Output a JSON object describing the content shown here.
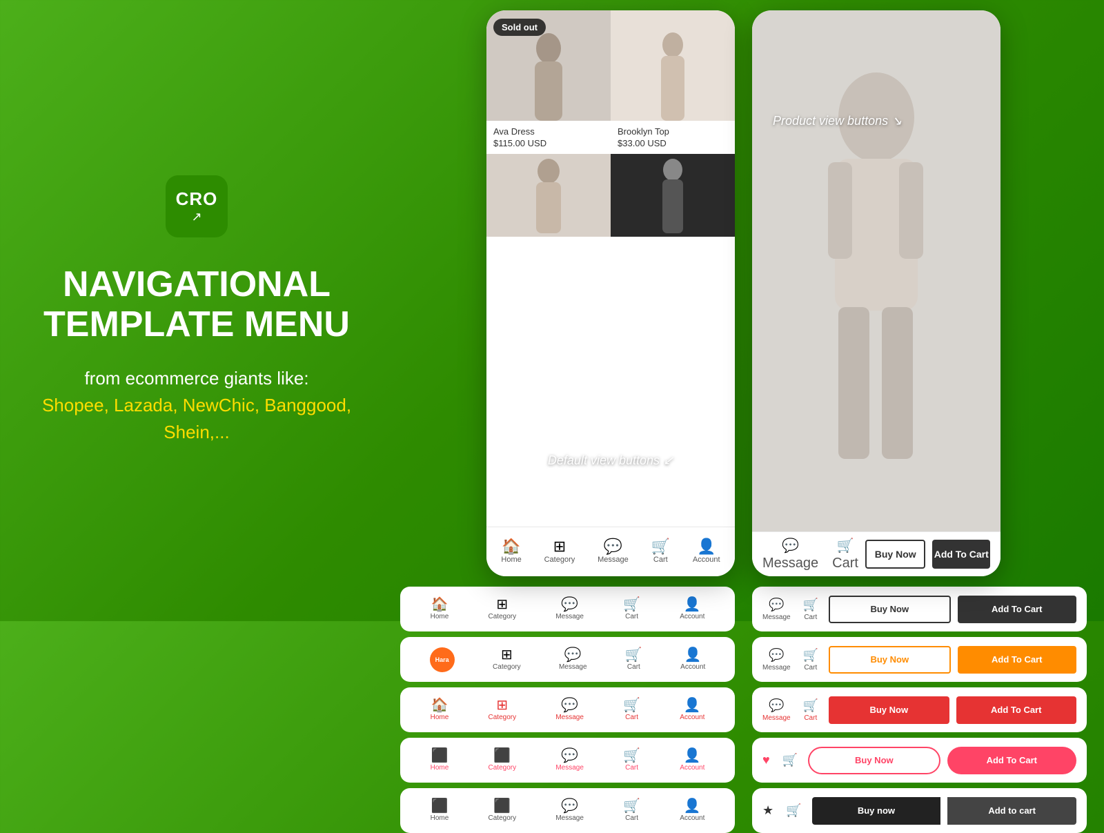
{
  "left": {
    "logo_text": "CRO",
    "title_line1": "NAVIGATIONAL",
    "title_line2": "TEMPLATE MENU",
    "subtitle_prefix": "from ecommerce giants like:",
    "subtitle_highlight": "Shopee, Lazada, NewChic, Banggood, Shein,..."
  },
  "phone_default": {
    "label": "Default view buttons",
    "products": [
      {
        "name": "Ava Dress",
        "price": "$115.00 USD",
        "sold_out": true
      },
      {
        "name": "Brooklyn Top",
        "price": "$33.00 USD",
        "sold_out": false
      }
    ],
    "nav": {
      "items": [
        {
          "icon": "🏠",
          "label": "Home"
        },
        {
          "icon": "⊞",
          "label": "Category"
        },
        {
          "icon": "💬",
          "label": "Message"
        },
        {
          "icon": "🛒",
          "label": "Cart"
        },
        {
          "icon": "👤",
          "label": "Account"
        }
      ]
    }
  },
  "phone_product": {
    "label": "Product view buttons",
    "nav_icons": [
      {
        "icon": "💬",
        "label": "Message"
      },
      {
        "icon": "🛒",
        "label": "Cart"
      }
    ],
    "buttons": {
      "buy_now": "Buy Now",
      "add_to_cart": "Add To Cart"
    }
  },
  "nav_rows": [
    {
      "type": "default",
      "items": [
        "Home",
        "Category",
        "Message",
        "Cart",
        "Account"
      ],
      "color": "default"
    },
    {
      "type": "hara",
      "items": [
        "Category",
        "Message",
        "Cart",
        "Account"
      ],
      "color": "default"
    },
    {
      "type": "red_outline",
      "items": [
        "Home",
        "Category",
        "Message",
        "Cart",
        "Account"
      ],
      "color": "red"
    },
    {
      "type": "red_filled",
      "items": [
        "Home",
        "Category",
        "Message",
        "Cart",
        "Account"
      ],
      "color": "red"
    },
    {
      "type": "dark",
      "items": [
        "Home",
        "Category",
        "Message",
        "Cart",
        "Account"
      ],
      "color": "dark"
    }
  ],
  "btn_rows": [
    {
      "style": "outline_solid",
      "buy_now": "Buy Now",
      "add_to_cart": "Add To Cart",
      "icon_color": "default"
    },
    {
      "style": "orange",
      "buy_now": "Buy Now",
      "add_to_cart": "Add To Cart",
      "icon_color": "default"
    },
    {
      "style": "red",
      "buy_now": "Buy Now",
      "add_to_cart": "Add To Cart",
      "icon_color": "red"
    },
    {
      "style": "pink_round",
      "buy_now": "Buy Now",
      "add_to_cart": "Add To Cart",
      "icon_color": "pink"
    },
    {
      "style": "dark_split",
      "buy_now": "Buy now",
      "add_to_cart": "Add to cart",
      "icon_color": "dark"
    }
  ]
}
